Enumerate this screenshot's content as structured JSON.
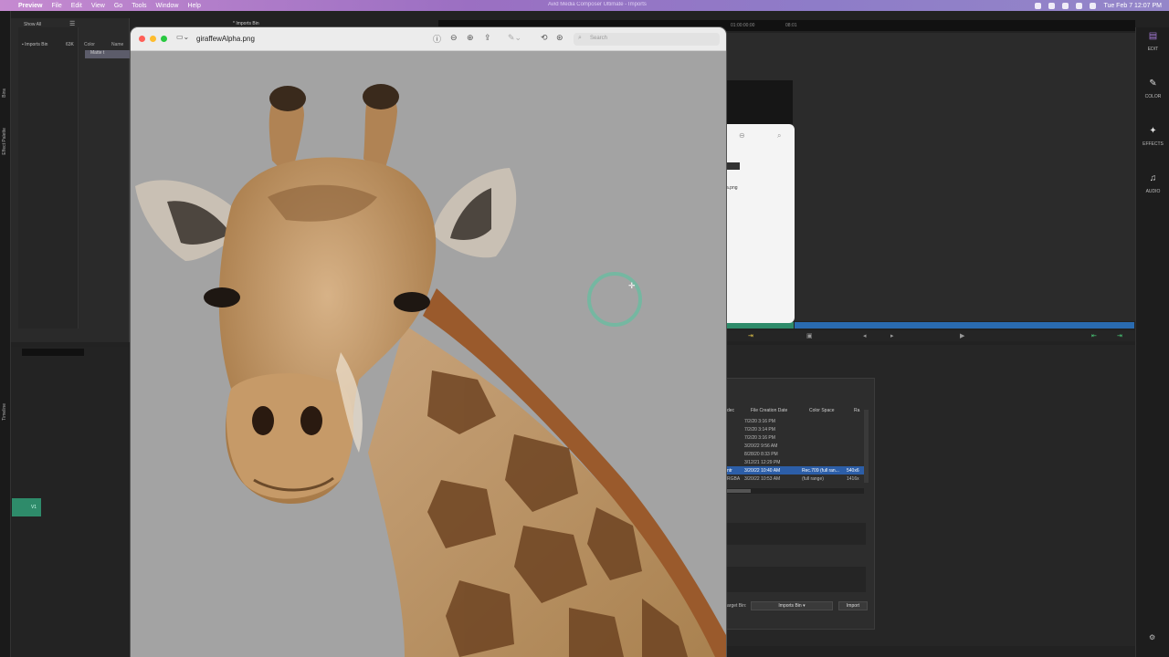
{
  "menubar": {
    "apple": "",
    "app_name": "Preview",
    "items": [
      "File",
      "Edit",
      "View",
      "Go",
      "Tools",
      "Window",
      "Help"
    ],
    "window_title": "Avid Media Composer Ultimate - Imports",
    "datetime": "Tue Feb 7  12:07 PM"
  },
  "avid": {
    "show_all": "Show All",
    "bins_label": "Bins",
    "effect_palette_label": "Effect Palette",
    "timeline_label": "Timeline",
    "bin_tab": "* Imports Bin",
    "bin_item": "Imports Bin",
    "bin_size": "63K",
    "col_color": "Color",
    "col_name": "Name",
    "selected_row": "Matte t",
    "timecode_1": "01:00:00:00",
    "timecode_2": "08:01",
    "track_v1": "V1",
    "rail": {
      "edit": "EDIT",
      "color": "COLOR",
      "effects": "EFFECTS",
      "audio": "AUDIO"
    }
  },
  "import_dialog": {
    "col_codec": "dec",
    "col_file_creation_date": "File Creation Date",
    "col_color_space": "Color Space",
    "col_ra": "Ra",
    "rows": [
      {
        "prefix": "",
        "date": "7/2/20 3:16 PM",
        "color_space": "",
        "extra": ""
      },
      {
        "prefix": "",
        "date": "7/2/20 3:14 PM",
        "color_space": "",
        "extra": ""
      },
      {
        "prefix": "",
        "date": "7/2/20 3:16 PM",
        "color_space": "",
        "extra": ""
      },
      {
        "prefix": "",
        "date": "3/20/22 9:56 AM",
        "color_space": "",
        "extra": ""
      },
      {
        "prefix": "",
        "date": "8/28/20 8:33 PM",
        "color_space": "",
        "extra": ""
      },
      {
        "prefix": "",
        "date": "3/12/21 12:29 PM",
        "color_space": "",
        "extra": ""
      },
      {
        "prefix": "ntr",
        "date": "3/20/22 10:40 AM",
        "color_space": "Rec.709 (full ran...",
        "extra": "540x6"
      },
      {
        "prefix": "RGBA",
        "date": "3/20/22 10:53 AM",
        "color_space": "(full range)",
        "extra": "1416x"
      }
    ],
    "target_bin_label": "arget Bin:",
    "target_bin_value": "Imports Bin",
    "import_button": "Import"
  },
  "finder": {
    "file_label": "a.png"
  },
  "preview": {
    "filename": "giraffewAlpha.png",
    "search_placeholder": "Search"
  },
  "colors": {
    "menubar_accent": "#9b6fc2",
    "avid_green": "#2e8b6a",
    "avid_blue": "#2a6bb0",
    "preview_bg": "#a3a3a3",
    "cursor_ring": "#50c8a0"
  }
}
